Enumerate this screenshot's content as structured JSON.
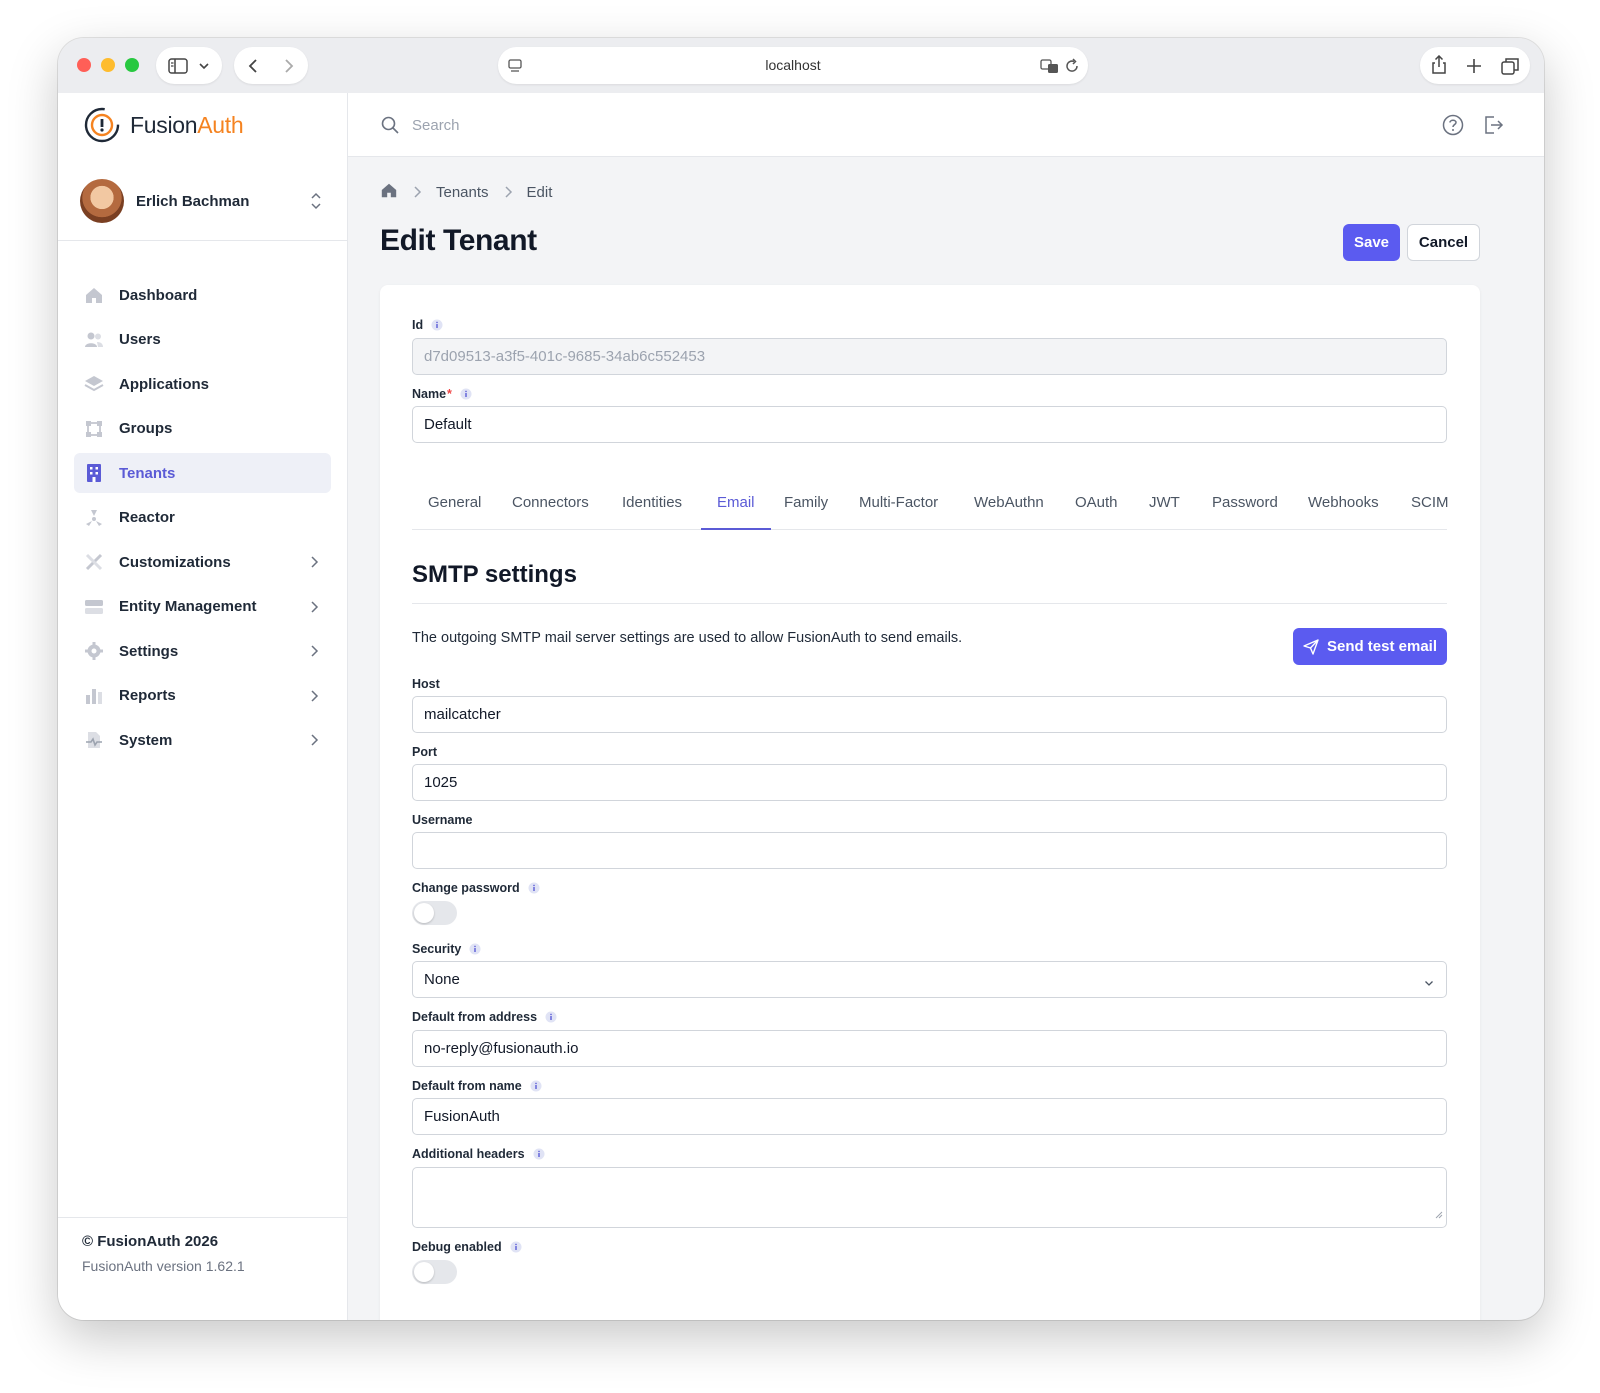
{
  "browser": {
    "url": "localhost"
  },
  "sidebar": {
    "logo": {
      "part1": "Fusion",
      "part2": "Auth"
    },
    "user_name": "Erlich Bachman",
    "items": [
      {
        "label": "Dashboard",
        "icon": "home-icon",
        "expandable": false
      },
      {
        "label": "Users",
        "icon": "users-icon",
        "expandable": false
      },
      {
        "label": "Applications",
        "icon": "layers-icon",
        "expandable": false
      },
      {
        "label": "Groups",
        "icon": "group-icon",
        "expandable": false
      },
      {
        "label": "Tenants",
        "icon": "building-icon",
        "expandable": false,
        "active": true
      },
      {
        "label": "Reactor",
        "icon": "reactor-icon",
        "expandable": false
      },
      {
        "label": "Customizations",
        "icon": "tools-icon",
        "expandable": true
      },
      {
        "label": "Entity Management",
        "icon": "server-icon",
        "expandable": true
      },
      {
        "label": "Settings",
        "icon": "gear-icon",
        "expandable": true
      },
      {
        "label": "Reports",
        "icon": "bar-chart-icon",
        "expandable": true
      },
      {
        "label": "System",
        "icon": "system-icon",
        "expandable": true
      }
    ],
    "copyright": "© FusionAuth 2026",
    "version": "FusionAuth version 1.62.1"
  },
  "topbar": {
    "search_placeholder": "Search"
  },
  "breadcrumb": {
    "crumb1": "Tenants",
    "crumb2": "Edit"
  },
  "page": {
    "title": "Edit Tenant",
    "save_label": "Save",
    "cancel_label": "Cancel"
  },
  "form": {
    "id_label": "Id",
    "id_value": "d7d09513-a3f5-401c-9685-34ab6c552453",
    "name_label": "Name",
    "name_required": "*",
    "name_value": "Default"
  },
  "tabs": [
    "General",
    "Connectors",
    "Identities",
    "Email",
    "Family",
    "Multi-Factor",
    "WebAuthn",
    "OAuth",
    "JWT",
    "Password",
    "Webhooks",
    "SCIM"
  ],
  "active_tab": "Email",
  "smtp": {
    "title": "SMTP settings",
    "description": "The outgoing SMTP mail server settings are used to allow FusionAuth to send emails.",
    "send_test_label": "Send test email",
    "host_label": "Host",
    "host_value": "mailcatcher",
    "port_label": "Port",
    "port_value": "1025",
    "username_label": "Username",
    "username_value": "",
    "change_password_label": "Change password",
    "change_password_on": false,
    "security_label": "Security",
    "security_value": "None",
    "from_address_label": "Default from address",
    "from_address_value": "no-reply@fusionauth.io",
    "from_name_label": "Default from name",
    "from_name_value": "FusionAuth",
    "headers_label": "Additional headers",
    "headers_value": "",
    "debug_label": "Debug enabled",
    "debug_on": false
  },
  "colors": {
    "accent": "#5b5bf0",
    "brand_orange": "#f58320",
    "active_nav": "#5b5bd6"
  }
}
